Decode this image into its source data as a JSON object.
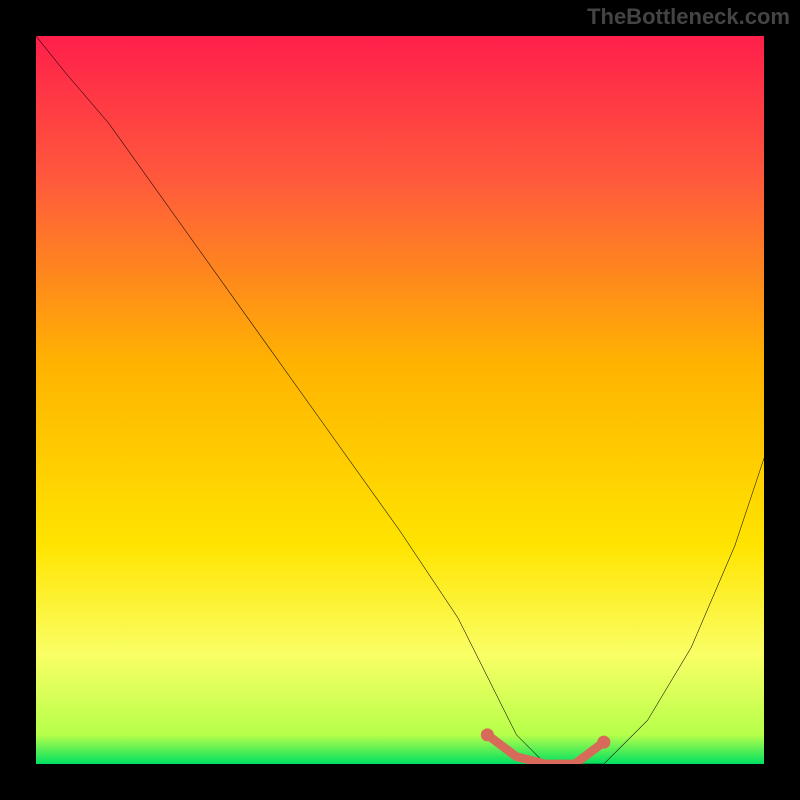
{
  "watermark": "TheBottleneck.com",
  "chart_data": {
    "type": "line",
    "title": "",
    "xlabel": "",
    "ylabel": "",
    "xlim": [
      0,
      100
    ],
    "ylim": [
      0,
      100
    ],
    "gradient_stops": [
      {
        "offset": 0,
        "color": "#ff1f4b"
      },
      {
        "offset": 20,
        "color": "#ff5a3c"
      },
      {
        "offset": 45,
        "color": "#ffb300"
      },
      {
        "offset": 70,
        "color": "#ffe400"
      },
      {
        "offset": 85,
        "color": "#faff66"
      },
      {
        "offset": 96,
        "color": "#b6ff4a"
      },
      {
        "offset": 100,
        "color": "#00e060"
      }
    ],
    "series": [
      {
        "name": "bottleneck-curve",
        "color": "#000000",
        "x": [
          0,
          4,
          10,
          20,
          30,
          40,
          50,
          58,
          62,
          66,
          70,
          74,
          78,
          84,
          90,
          96,
          100
        ],
        "y": [
          100,
          95,
          88,
          74,
          60,
          46,
          32,
          20,
          12,
          4,
          0,
          0,
          0,
          6,
          16,
          30,
          42
        ]
      }
    ],
    "highlight_segment": {
      "name": "optimal-range",
      "color": "#d86a5a",
      "x": [
        62,
        66,
        70,
        74,
        78
      ],
      "y": [
        4,
        1,
        0,
        0,
        3
      ]
    }
  }
}
